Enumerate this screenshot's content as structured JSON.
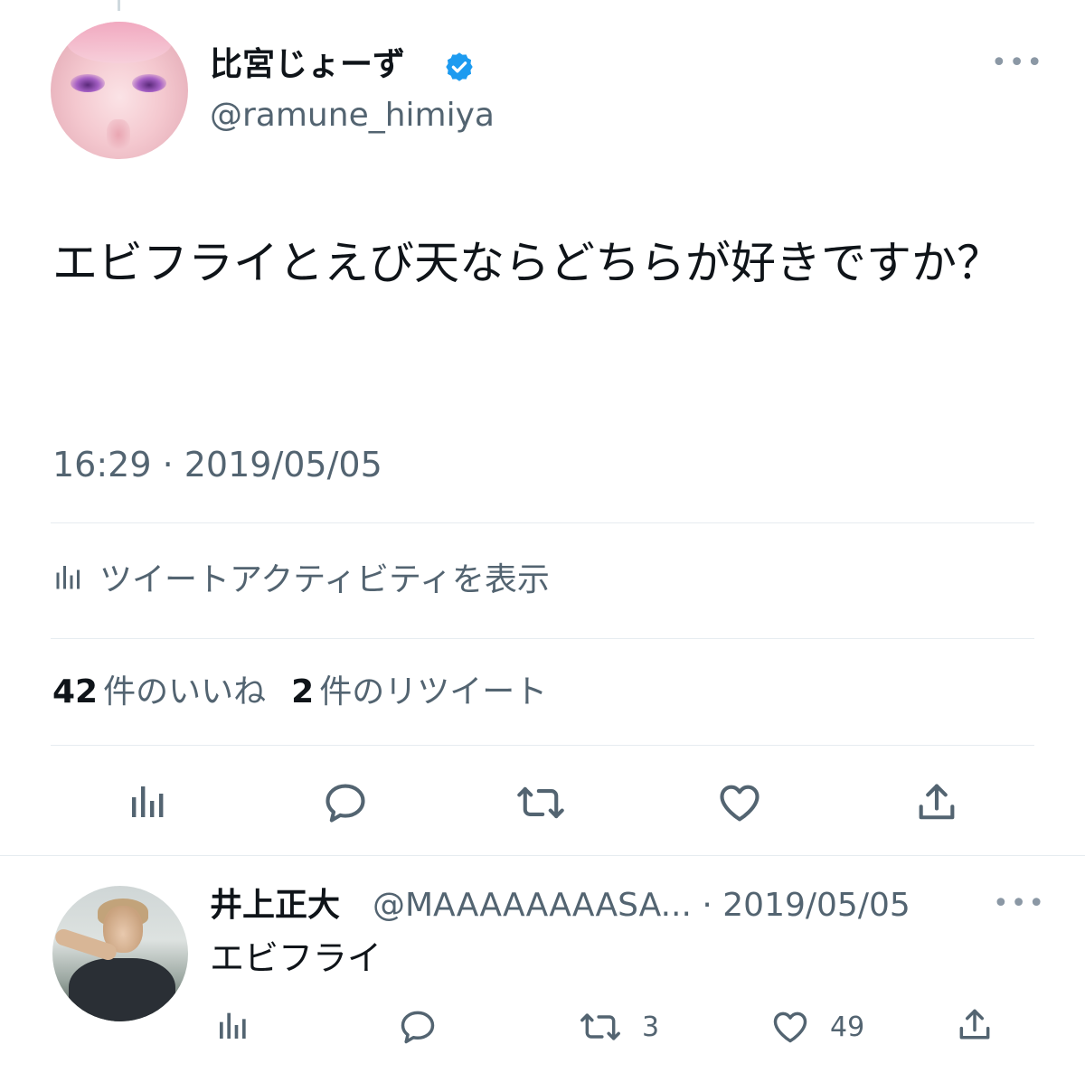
{
  "tweet": {
    "display_name": "比宮じょーず",
    "handle": "@ramune_himiya",
    "verified": true,
    "more_label": "•••",
    "text": "エビフライとえび天ならどちらが好きですか？",
    "timestamp": "16:29 · 2019/05/05",
    "activity_label": "ツイートアクティビティを表示",
    "likes_count": "42",
    "likes_label": "件のいいね",
    "retweets_count": "2",
    "retweets_label": "件のリツイート",
    "actions": [
      "analytics-icon",
      "reply-icon",
      "retweet-icon",
      "like-icon",
      "share-icon"
    ]
  },
  "reply": {
    "display_name": "井上正大",
    "handle_date": "@MAAAAAAAASA... · 2019/05/05",
    "more_label": "•••",
    "text": "エビフライ",
    "retweet_count": "3",
    "like_count": "49"
  },
  "colors": {
    "text_primary": "#0f1419",
    "text_secondary": "#536471",
    "verified_blue": "#1d9bf0",
    "divider": "#e6ecf0"
  }
}
